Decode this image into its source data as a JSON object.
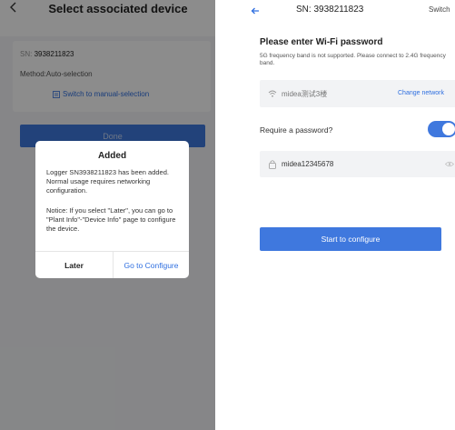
{
  "left_screen": {
    "header": {
      "title": "Select associated device"
    },
    "device_card": {
      "sn_label": "SN:",
      "sn_value": "3938211823",
      "method_text": "Method:Auto-selection",
      "switch_link": "Switch to manual-selection"
    },
    "done_button": "Done",
    "dialog": {
      "title": "Added",
      "message": "Logger SN3938211823 has been added. Normal usage requires networking configuration.",
      "notice": "Notice: If you select \"Later\", you can go to \"Plant Info\"-\"Device Info\" page to configure the device.",
      "later_button": "Later",
      "configure_button": "Go to Configure"
    }
  },
  "right_screen": {
    "header": {
      "title": "SN: 3938211823",
      "switch_label": "Switch"
    },
    "heading": "Please enter Wi-Fi password",
    "note": "5G frequency band is not supported. Please connect to 2.4G frequency band.",
    "wifi": {
      "name": "midea测试3楼",
      "change_link": "Change network"
    },
    "require_password": {
      "label": "Require a password?",
      "enabled": true
    },
    "password": {
      "value": "midea12345678"
    },
    "start_button": "Start to configure"
  },
  "colors": {
    "accent": "#3f78de",
    "link": "#2f6fe0",
    "screen_bg": "#f4f5f7",
    "field_bg": "#f2f3f5"
  }
}
